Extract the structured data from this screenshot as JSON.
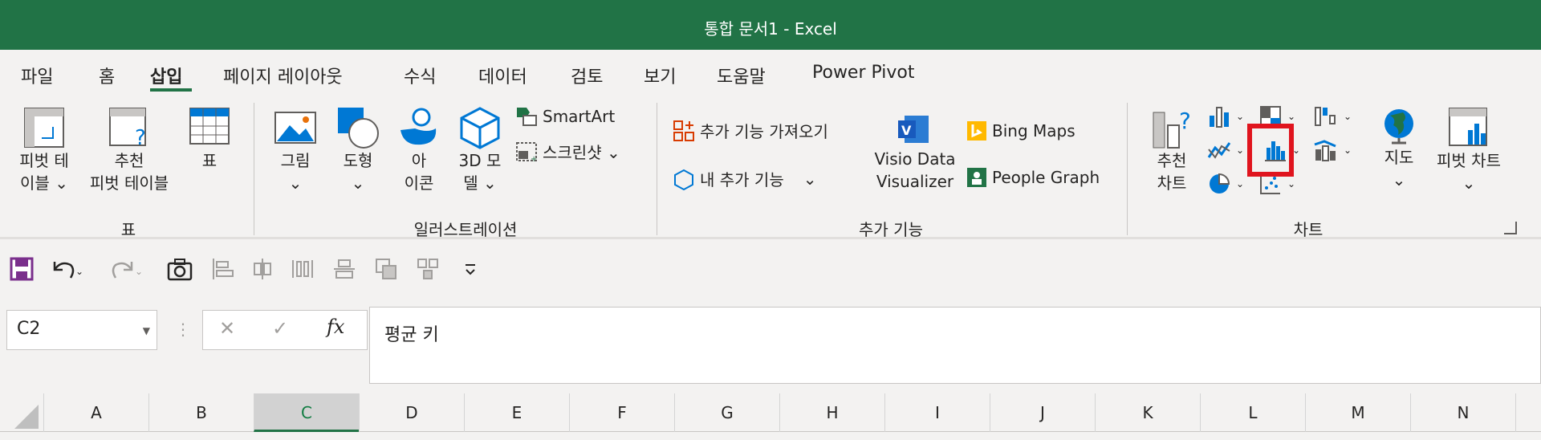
{
  "window": {
    "title": "통합 문서1  -  Excel"
  },
  "tabs": [
    "파일",
    "홈",
    "삽입",
    "페이지 레이아웃",
    "수식",
    "데이터",
    "검토",
    "보기",
    "도움말",
    "Power Pivot"
  ],
  "ribbon": {
    "tables": {
      "label": "표",
      "pivot_table": [
        "피벗 테",
        "이블 ⌄"
      ],
      "recommended_pivot": [
        "추천",
        "피벗 테이블"
      ],
      "table": "표"
    },
    "illustrations": {
      "label": "일러스트레이션",
      "pictures": [
        "그림",
        "⌄"
      ],
      "shapes": [
        "도형",
        "⌄"
      ],
      "icons": [
        "아",
        "이콘"
      ],
      "models3d": [
        "3D 모",
        "델 ⌄"
      ],
      "smartart": "SmartArt",
      "screenshot": "스크린샷 ⌄"
    },
    "addins": {
      "label": "추가 기능",
      "get_addins": "추가 기능 가져오기",
      "my_addins": "내 추가 기능",
      "my_addins_arrow": "⌄",
      "visio": [
        "Visio Data",
        "Visualizer"
      ],
      "bing_maps": "Bing Maps",
      "people_graph": "People Graph"
    },
    "charts": {
      "label": "차트",
      "recommended": [
        "추천",
        "차트"
      ],
      "maps": [
        "지도",
        "⌄"
      ],
      "pivot_chart": [
        "피벗 차트",
        "⌄"
      ]
    }
  },
  "formula_bar": {
    "name_box": "C2",
    "fx": "fx",
    "content": "평균 키"
  },
  "columns": [
    "A",
    "B",
    "C",
    "D",
    "E",
    "F",
    "G",
    "H",
    "I",
    "J",
    "K",
    "L",
    "M",
    "N"
  ],
  "selected_column": "C",
  "colors": {
    "accent": "#217346",
    "highlight": "#e0141e"
  }
}
